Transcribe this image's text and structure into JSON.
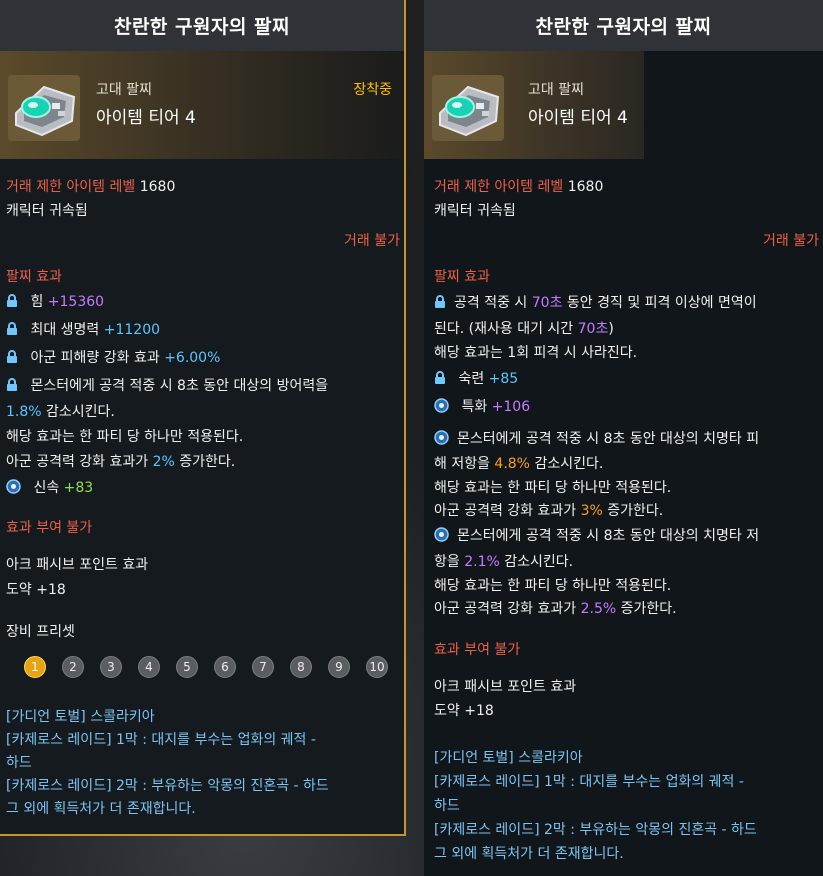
{
  "left": {
    "title": "찬란한 구원자의 팔찌",
    "grade": "고대 팔찌",
    "tier": "아이템 티어 4",
    "equipped": "장착중",
    "trade_level_label": "거래 제한 아이템 레벨",
    "trade_level_value": "1680",
    "bound": "캐릭터 귀속됨",
    "no_trade": "거래 불가",
    "effect_header": "팔찌 효과",
    "effects": [
      {
        "label": "힘",
        "value": "+15360",
        "icon": "lock-icon"
      },
      {
        "label": "최대 생명력",
        "value": "+11200",
        "icon": "lock-icon"
      },
      {
        "label": "아군 피해량 강화 효과",
        "value": "+6.00%",
        "icon": "lock-icon"
      },
      {
        "label": "몬스터에게 공격 적중 시 8초 동안 대상의 방어력을",
        "icon": "lock-icon"
      }
    ],
    "effect4_cont_value": "1.8%",
    "effect4_cont_text": " 감소시킨다.",
    "effect4_note1": "해당 효과는 한 파티 당 하나만 적용된다.",
    "effect4_note2_pre": "아군 공격력 강화 효과가 ",
    "effect4_note2_value": "2%",
    "effect4_note2_post": " 증가한다.",
    "effect5_label": "신속",
    "effect5_value": "+83",
    "no_grant": "효과 부여 불가",
    "ark_header": "아크 패시브 포인트 효과",
    "ark_value": "도약 +18",
    "preset_header": "장비 프리셋",
    "presets": [
      "1",
      "2",
      "3",
      "4",
      "5",
      "6",
      "7",
      "8",
      "9",
      "10"
    ],
    "sources": [
      "[가디언 토벌] 스콜라키아",
      "[카제로스 레이드] 1막 : 대지를 부수는 업화의 궤적 -",
      "하드",
      "[카제로스 레이드] 2막 : 부유하는 악몽의 진혼곡 - 하드",
      "그 외에 획득처가 더 존재합니다."
    ]
  },
  "right": {
    "title": "찬란한 구원자의 팔찌",
    "grade": "고대 팔찌",
    "tier": "아이템 티어 4",
    "trade_level_label": "거래 제한 아이템 레벨",
    "trade_level_value": "1680",
    "bound": "캐릭터 귀속됨",
    "no_trade": "거래 불가",
    "effect_header": "팔찌 효과",
    "e1_pre": "공격 적중 시 ",
    "e1_val": "70초",
    "e1_post": " 동안 경직 및 피격 이상에 면역이",
    "e1_line2_pre": "된다. (재사용 대기 시간 ",
    "e1_line2_val": "70초",
    "e1_line2_post": ")",
    "e1_line3": "해당 효과는 1회 피격 시 사라진다.",
    "e2_label": "숙련",
    "e2_value": "+85",
    "e3_label": "특화",
    "e3_value": "+106",
    "e4_line1": "몬스터에게 공격 적중 시 8초 동안 대상의 치명타 피",
    "e4_line2_pre": "해 저항을 ",
    "e4_line2_val": "4.8%",
    "e4_line2_post": " 감소시킨다.",
    "e4_line3": "해당 효과는 한 파티 당 하나만 적용된다.",
    "e4_line4_pre": "아군 공격력 강화 효과가 ",
    "e4_line4_val": "3%",
    "e4_line4_post": " 증가한다.",
    "e5_line1": "몬스터에게 공격 적중 시 8초 동안 대상의 치명타 저",
    "e5_line2_pre": "항을 ",
    "e5_line2_val": "2.1%",
    "e5_line2_post": " 감소시킨다.",
    "e5_line3": "해당 효과는 한 파티 당 하나만 적용된다.",
    "e5_line4_pre": "아군 공격력 강화 효과가 ",
    "e5_line4_val": "2.5%",
    "e5_line4_post": " 증가한다.",
    "no_grant": "효과 부여 불가",
    "ark_header": "아크 패시브 포인트 효과",
    "ark_value": "도약 +18",
    "sources": [
      "[가디언 토벌] 스콜라키아",
      "[카제로스 레이드] 1막 : 대지를 부수는 업화의 궤적 -",
      "하드",
      "[카제로스 레이드] 2막 : 부유하는 악몽의 진혼곡 - 하드",
      "그 외에 획득처가 더 존재합니다."
    ]
  },
  "colors": {
    "accent_gold": "#c9932d",
    "equipped": "#ffc000",
    "red": "#ec6047",
    "purple": "#c47bff",
    "blue": "#5ac6ff",
    "green": "#8fe14a",
    "orange": "#ff9f19",
    "link": "#7dc4f2"
  }
}
